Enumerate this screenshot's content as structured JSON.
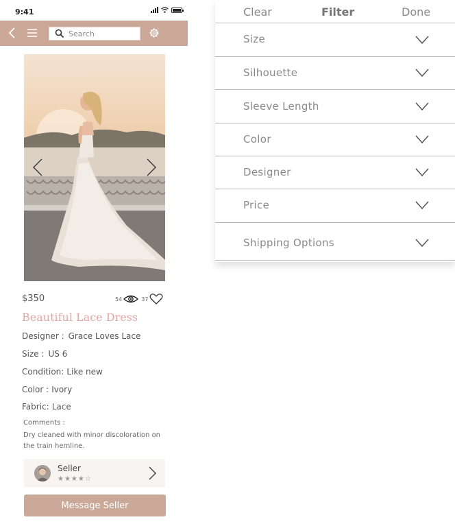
{
  "status_bar": {
    "time": "9:41"
  },
  "search": {
    "placeholder": "Search"
  },
  "product": {
    "price": "$350",
    "views": "54",
    "likes": "37",
    "title": "Beautiful Lace Dress",
    "details": [
      {
        "label": "Designer :",
        "value": "Grace Loves Lace"
      },
      {
        "label": "Size :",
        "value": "US 6"
      },
      {
        "label": "Condition:",
        "value": "Like new"
      },
      {
        "label": "Color :",
        "value": "Ivory"
      },
      {
        "label": "Fabric:",
        "value": "Lace"
      }
    ],
    "comments_label": "Comments :",
    "comments_text": "Dry cleaned with minor discoloration on the train hemline."
  },
  "seller": {
    "name": "Seller",
    "stars": "★★★★☆",
    "rating": 4
  },
  "message_button": "Message Seller",
  "filter": {
    "clear": "Clear",
    "title": "Filter",
    "done": "Done",
    "options": [
      "Size",
      "Silhouette",
      "Sleeve Length",
      "Color",
      "Designer",
      "Price",
      "Shipping Options"
    ]
  },
  "colors": {
    "brand": "#cba898",
    "title_pink": "#e0a7a4",
    "divider": "#b9b9b9"
  },
  "icons": [
    "back-icon",
    "menu-icon",
    "search-icon",
    "settings-icon",
    "chevron-left-icon",
    "chevron-right-icon",
    "eye-icon",
    "heart-icon",
    "chevron-down-icon"
  ]
}
